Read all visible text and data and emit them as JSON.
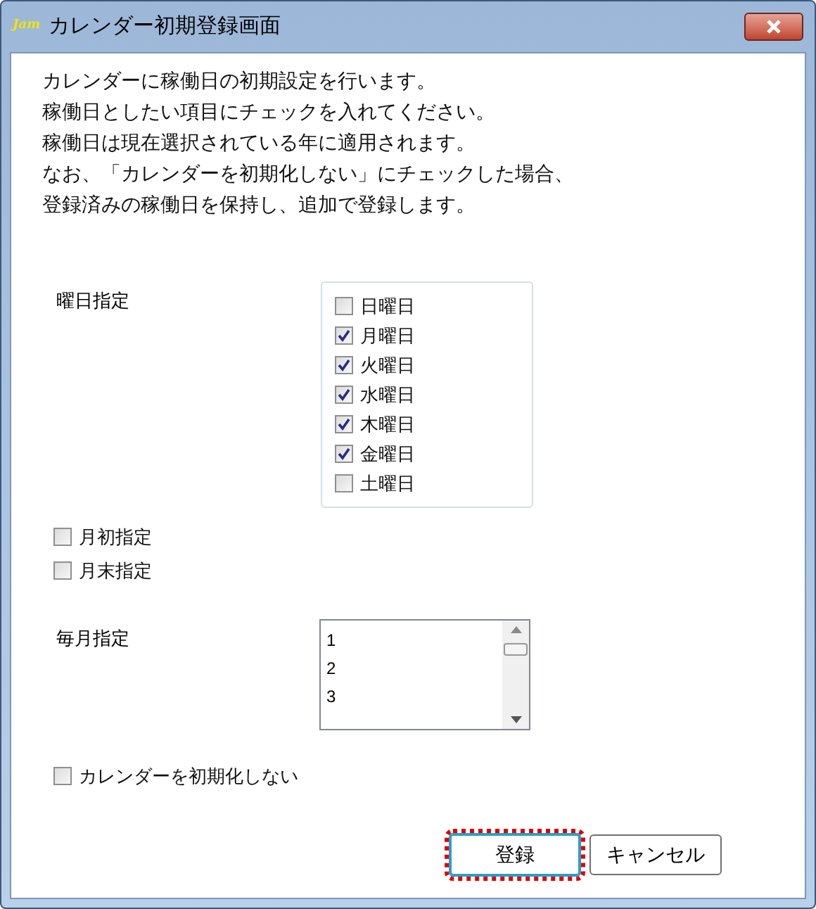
{
  "window": {
    "title": "カレンダー初期登録画面",
    "logo": "Jam"
  },
  "description": [
    "カレンダーに稼働日の初期設定を行います。",
    "稼働日としたい項目にチェックを入れてください。",
    "稼働日は現在選択されている年に適用されます。",
    "なお、「カレンダーを初期化しない」にチェックした場合、",
    "登録済みの稼働日を保持し、追加で登録します。"
  ],
  "weekday_label": "曜日指定",
  "weekdays": [
    {
      "label": "日曜日",
      "checked": false
    },
    {
      "label": "月曜日",
      "checked": true
    },
    {
      "label": "火曜日",
      "checked": true
    },
    {
      "label": "水曜日",
      "checked": true
    },
    {
      "label": "木曜日",
      "checked": true
    },
    {
      "label": "金曜日",
      "checked": true
    },
    {
      "label": "土曜日",
      "checked": false
    }
  ],
  "month_options": [
    {
      "label": "月初指定",
      "checked": false
    },
    {
      "label": "月末指定",
      "checked": false
    }
  ],
  "monthly_label": "毎月指定",
  "monthly_days": [
    "1",
    "2",
    "3"
  ],
  "keep_calendar": {
    "label": "カレンダーを初期化しない",
    "checked": false
  },
  "buttons": [
    {
      "label": "登録",
      "focused": true
    },
    {
      "label": "キャンセル",
      "focused": false
    }
  ]
}
